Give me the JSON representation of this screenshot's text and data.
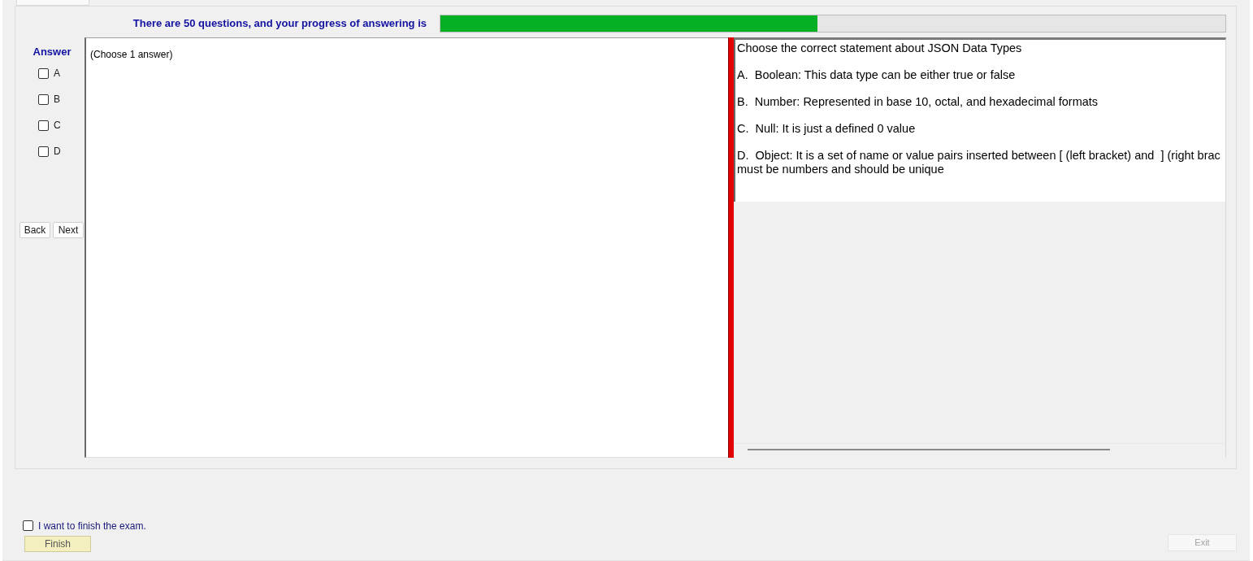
{
  "progress": {
    "text": "There are 50 questions, and your progress of answering is",
    "level": 0.48
  },
  "answer_panel": {
    "title": "Answer",
    "options": [
      {
        "label": "A",
        "checked": false
      },
      {
        "label": "B",
        "checked": false
      },
      {
        "label": "C",
        "checked": false
      },
      {
        "label": "D",
        "checked": false
      }
    ],
    "buttons": [
      "Back",
      "Next"
    ]
  },
  "instruction": {
    "text": "(Choose 1 answer)"
  },
  "question": {
    "title": "Choose the correct statement about JSON Data Types",
    "options": [
      {
        "lines": [
          "A.  Boolean: This data type can be either true or false"
        ]
      },
      {
        "lines": [
          "B.  Number: Represented in base 10, octal, and hexadecimal formats"
        ]
      },
      {
        "lines": [
          "C.  Null: It is just a defined 0 value"
        ]
      },
      {
        "lines": [
          "D.  Object: It is a set of name or value pairs inserted between [ (left bracket) and  ] (right brac",
          "must be numbers and should be unique"
        ]
      }
    ]
  },
  "footer": {
    "finish_confirm": {
      "label": "I want to finish the exam.",
      "checked": false
    },
    "finish_button": {
      "label": "Finish"
    },
    "exit_button": {
      "label": "Exit",
      "disabled": true
    }
  }
}
